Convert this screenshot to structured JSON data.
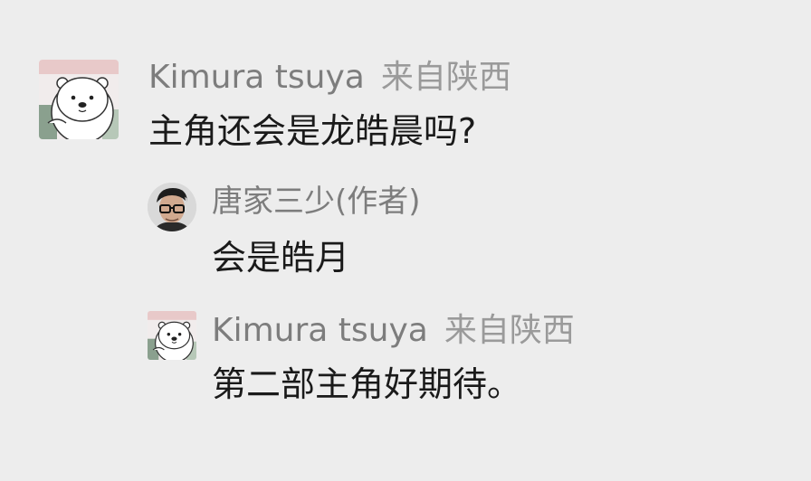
{
  "comments": [
    {
      "author": "Kimura tsuya",
      "location": "来自陕西",
      "text": "主角还会是龙皓晨吗?",
      "avatar_icon": "polar-bear-avatar-icon"
    },
    {
      "author": "唐家三少(作者)",
      "location": "",
      "text": "会是皓月",
      "avatar_icon": "author-photo-avatar-icon"
    },
    {
      "author": "Kimura tsuya",
      "location": "来自陕西",
      "text": "第二部主角好期待。",
      "avatar_icon": "polar-bear-avatar-icon"
    }
  ],
  "colors": {
    "background": "#ededed",
    "author_text": "#7d7d7d",
    "location_text": "#9a9a9a",
    "body_text": "#1a1a1a"
  }
}
